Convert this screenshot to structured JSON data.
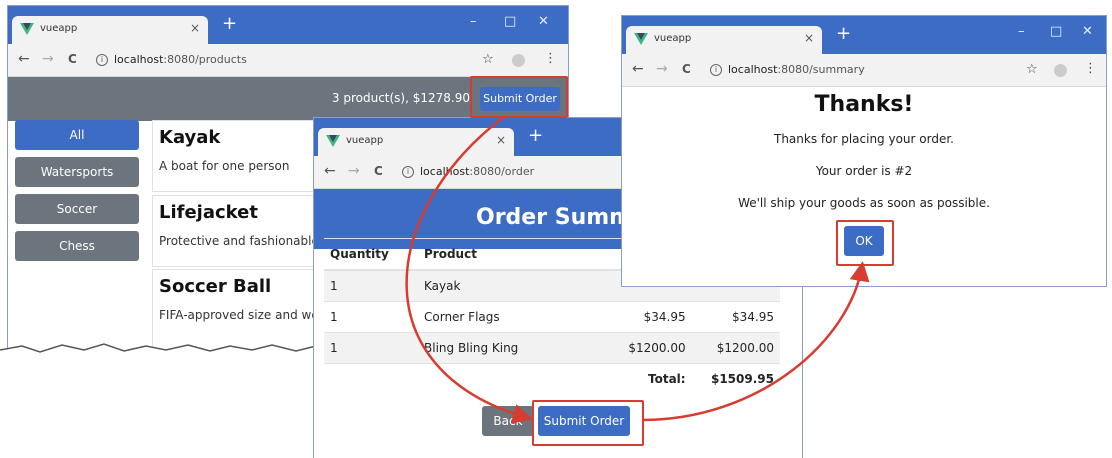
{
  "colors": {
    "accent": "#3d6cc4",
    "secondary": "#6c757d",
    "highlight": "#d83b2f"
  },
  "browser": {
    "tab_title": "vueapp",
    "new_tab": "+",
    "close_tab": "×",
    "minimize": "–",
    "maximize": "□",
    "close_window": "✕",
    "back": "←",
    "forward": "→",
    "reload": "C",
    "info": "i",
    "host": "localhost",
    "star": "☆",
    "menu": "⋮"
  },
  "products_window": {
    "url_path": ":8080/products",
    "order_summary": "3 product(s), $1278.90",
    "submit_label": "Submit Order",
    "categories": [
      "All",
      "Watersports",
      "Soccer",
      "Chess"
    ],
    "products": [
      {
        "name": "Kayak",
        "description": "A boat for one person"
      },
      {
        "name": "Lifejacket",
        "description": "Protective and fashionable"
      },
      {
        "name": "Soccer Ball",
        "description": "FIFA-approved size and we"
      }
    ]
  },
  "order_window": {
    "url_path": ":8080/order",
    "title": "Order Summa",
    "headers": [
      "Quantity",
      "Product",
      "",
      ""
    ],
    "rows": [
      {
        "qty": "1",
        "product": "Kayak",
        "price": "",
        "subtotal": ""
      },
      {
        "qty": "1",
        "product": "Corner Flags",
        "price": "$34.95",
        "subtotal": "$34.95"
      },
      {
        "qty": "1",
        "product": "Bling Bling King",
        "price": "$1200.00",
        "subtotal": "$1200.00"
      }
    ],
    "total_label": "Total:",
    "total_value": "$1509.95",
    "back_label": "Back",
    "submit_label": "Submit Order"
  },
  "summary_window": {
    "url_path": ":8080/summary",
    "heading": "Thanks!",
    "line1": "Thanks for placing your order.",
    "line2": "Your order is #2",
    "line3": "We'll ship your goods as soon as possible.",
    "ok_label": "OK"
  }
}
